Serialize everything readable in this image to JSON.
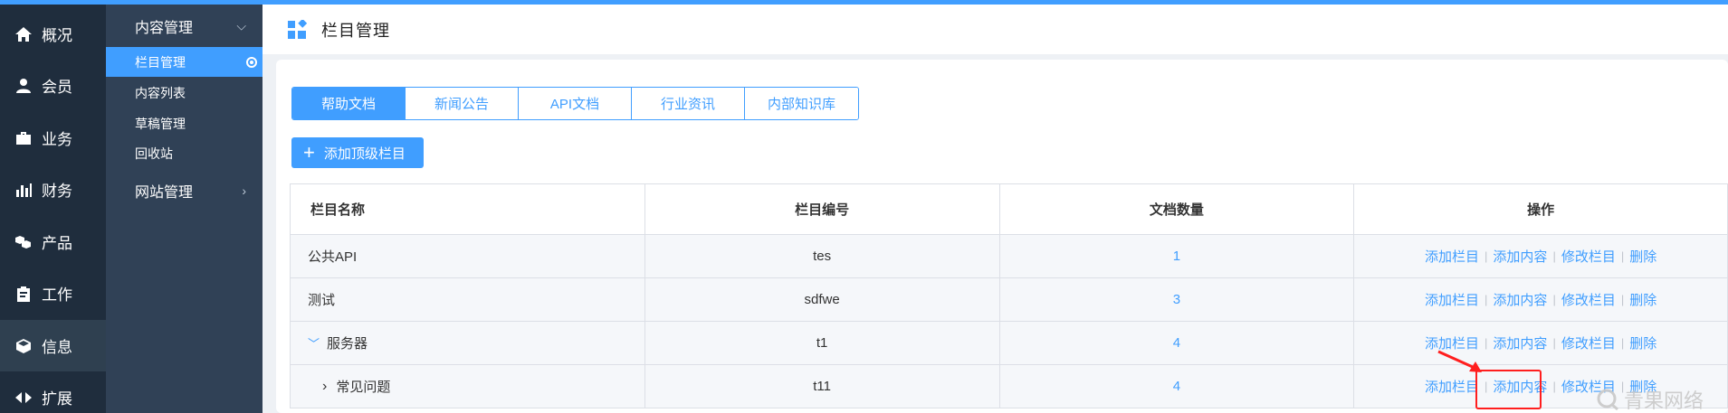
{
  "primary_nav": [
    {
      "label": "概况",
      "icon": "home-icon",
      "active": false
    },
    {
      "label": "会员",
      "icon": "user-icon",
      "active": false
    },
    {
      "label": "业务",
      "icon": "briefcase-icon",
      "active": false
    },
    {
      "label": "财务",
      "icon": "bar-chart-icon",
      "active": false
    },
    {
      "label": "产品",
      "icon": "cubes-icon",
      "active": false
    },
    {
      "label": "工作",
      "icon": "clipboard-icon",
      "active": false
    },
    {
      "label": "信息",
      "icon": "cube-icon",
      "active": true
    },
    {
      "label": "扩展",
      "icon": "arrows-icon",
      "active": false
    }
  ],
  "secondary_nav": {
    "groups": [
      {
        "label": "内容管理",
        "expanded": true,
        "items": [
          {
            "label": "栏目管理",
            "active": true
          },
          {
            "label": "内容列表",
            "active": false
          },
          {
            "label": "草稿管理",
            "active": false
          },
          {
            "label": "回收站",
            "active": false
          }
        ]
      },
      {
        "label": "网站管理",
        "expanded": false,
        "items": []
      }
    ]
  },
  "header": {
    "title": "栏目管理"
  },
  "tabs": [
    {
      "label": "帮助文档",
      "active": true
    },
    {
      "label": "新闻公告",
      "active": false
    },
    {
      "label": "API文档",
      "active": false
    },
    {
      "label": "行业资讯",
      "active": false
    },
    {
      "label": "内部知识库",
      "active": false
    }
  ],
  "add_top_button": {
    "label": "添加顶级栏目"
  },
  "table": {
    "columns": [
      "栏目名称",
      "栏目编号",
      "文档数量",
      "操作"
    ],
    "rows": [
      {
        "name": "公共API",
        "code": "tes",
        "count": "1",
        "level": 1,
        "tree": ""
      },
      {
        "name": "测试",
        "code": "sdfwe",
        "count": "3",
        "level": 1,
        "tree": ""
      },
      {
        "name": "服务器",
        "code": "t1",
        "count": "4",
        "level": 1,
        "tree": "expanded"
      },
      {
        "name": "常见问题",
        "code": "t11",
        "count": "4",
        "level": 2,
        "tree": "collapsed"
      }
    ],
    "actions": [
      "添加栏目",
      "添加内容",
      "修改栏目",
      "删除"
    ]
  },
  "annotation": {
    "highlight_color": "#ff1e1e"
  },
  "watermark": {
    "text": "青果网络"
  },
  "colors": {
    "accent": "#409eff",
    "sidebar": "#1f2d3d",
    "subsidebar": "#304156"
  }
}
